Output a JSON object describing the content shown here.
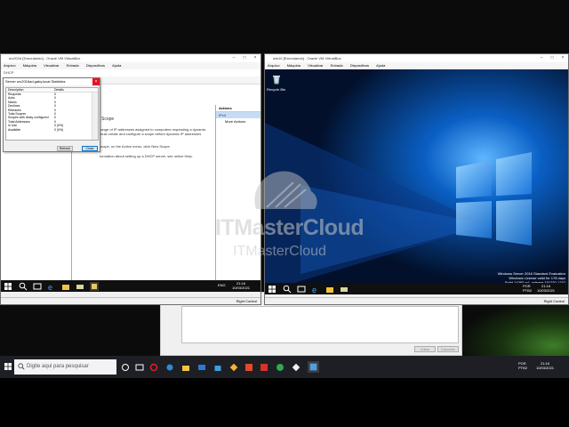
{
  "host": {
    "search_placeholder": "Digite aqui para pesquisar",
    "tray_lang": "POR",
    "tray_layout": "PTB2",
    "clock_time": "21:16",
    "clock_date": "10/03/2021",
    "dialog_btn1": "Voltar",
    "dialog_btn2": "Cancelar"
  },
  "vm1": {
    "title": "srv2016 [Executando] - Oracle VM VirtualBox",
    "menu": [
      "Arquivo",
      "Máquina",
      "Visualizar",
      "Entrada",
      "Dispositivos",
      "Ajuda"
    ],
    "dhcp_title": "DHCP",
    "statistics": {
      "title": "Server srv2016ad.gaby.local Statistics",
      "col_description": "Description",
      "col_details": "Details",
      "rows": [
        {
          "desc": "Requests",
          "val": "0"
        },
        {
          "desc": "Acks",
          "val": "0"
        },
        {
          "desc": "Nacks",
          "val": "0"
        },
        {
          "desc": "Declines",
          "val": "0"
        },
        {
          "desc": "Releases",
          "val": "0"
        },
        {
          "desc": "Total Scopes",
          "val": "0"
        },
        {
          "desc": "Scopes with delay configured",
          "val": "0"
        },
        {
          "desc": "Total Addresses",
          "val": "0"
        },
        {
          "desc": "In Use",
          "val": "0 (0%)"
        },
        {
          "desc": "Available",
          "val": "0 (0%)"
        }
      ],
      "refresh_label": "Refresh",
      "close_label": "Close"
    },
    "center_texts": [
      "Scope",
      "range of IP addresses assigned to computers requesting a dynamic",
      "must create and configure a scope before dynamic IP addresses",
      "scope, on the Action menu, click New Scope.",
      "formation about setting up a DHCP server, see online Help."
    ],
    "actions": {
      "header": "Actions",
      "selected": "IPv4",
      "more": "More Actions"
    },
    "taskbar_lang": "ENG",
    "taskbar_time": "21:16",
    "taskbar_date": "10/03/2021",
    "status_right": "Right Control"
  },
  "vm2": {
    "title": "win10 [Executando] - Oracle VM VirtualBox",
    "menu": [
      "Arquivo",
      "Máquina",
      "Visualizar",
      "Entrada",
      "Dispositivos",
      "Ajuda"
    ],
    "recycle_bin": "Recycle Bin",
    "watermark_line1": "Windows Server 2016 Standard Evaluation",
    "watermark_line2": "Windows License valid for 178 days",
    "watermark_line3": "Build 14393.rs1_release.161220-1747",
    "taskbar_lang": "POR",
    "taskbar_layout": "PTB2",
    "taskbar_time": "21:16",
    "taskbar_date": "10/03/2021",
    "status_right": "Right Control"
  },
  "watermark": {
    "brand1": "ITMasterCloud",
    "brand2": "ITMasterCloud"
  },
  "colors": {
    "accent_blue": "#0078d7",
    "close_red": "#e81123",
    "taskbar": "#101010"
  }
}
